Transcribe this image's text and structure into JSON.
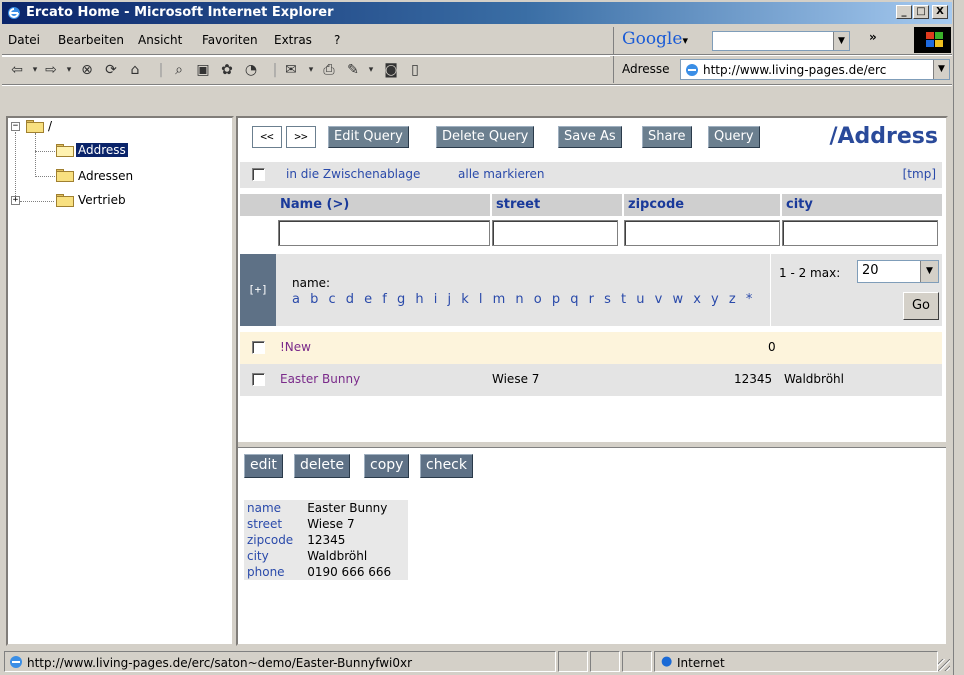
{
  "window": {
    "title": "Ercato Home - Microsoft Internet Explorer",
    "min_label": "_",
    "max_label": "□",
    "close_label": "X"
  },
  "menu": [
    "Datei",
    "Bearbeiten",
    "Ansicht",
    "Favoriten",
    "Extras",
    "?"
  ],
  "google": {
    "logo": "Google",
    "dropdown": "▾",
    "more": "»"
  },
  "nav_icons": [
    "back-arrow-icon",
    "forward-arrow-icon",
    "stop-icon",
    "refresh-icon",
    "home-icon",
    "search-icon",
    "favorites-icon",
    "media-icon",
    "history-icon",
    "mail-icon",
    "print-icon",
    "edit-icon",
    "discuss-icon",
    "messenger-icon"
  ],
  "address": {
    "label": "Adresse",
    "url": "http://www.living-pages.de/erc"
  },
  "tree": {
    "root": "/",
    "items": [
      "Address",
      "Adressen",
      "Vertrieb"
    ],
    "selected": "Address"
  },
  "query_toolbar": {
    "prev": "<<",
    "next": ">>",
    "buttons": [
      "Edit Query",
      "Delete Query",
      "Save As",
      "Share",
      "Query"
    ],
    "page_title": "/Address"
  },
  "select_bar": {
    "clipboard": "in die Zwischenablage",
    "mark_all": "alle markieren",
    "tmp": "[tmp]"
  },
  "columns": [
    "Name (>)",
    "street",
    "zipcode",
    "city"
  ],
  "alpha": {
    "expand": "[+]",
    "label": "name:",
    "letters": "a b c d e f g h i j k l m n o p q r s t u v w x y z *",
    "range": "1 - 2 max:",
    "max_value": "20",
    "go": "Go"
  },
  "rows": [
    {
      "name": "!New",
      "street": "",
      "zipcode": "0",
      "city": ""
    },
    {
      "name": "Easter Bunny",
      "street": "Wiese 7",
      "zipcode": "12345",
      "city": "Waldbröhl"
    }
  ],
  "actions": [
    "edit",
    "delete",
    "copy",
    "check"
  ],
  "detail": [
    {
      "key": "name",
      "value": "Easter Bunny"
    },
    {
      "key": "street",
      "value": "Wiese 7"
    },
    {
      "key": "zipcode",
      "value": "12345"
    },
    {
      "key": "city",
      "value": "Waldbröhl"
    },
    {
      "key": "phone",
      "value": "0190 666 666"
    }
  ],
  "status": {
    "url": "http://www.living-pages.de/erc/saton~demo/Easter-Bunnyfwi0xr",
    "zone": "Internet"
  },
  "colors": {
    "titlebar": "#0a246a",
    "button": "#6b7f8f",
    "link": "#2a4aaa",
    "highlight_row": "#fdf4dc",
    "selected_row": "#e4e4e4"
  }
}
